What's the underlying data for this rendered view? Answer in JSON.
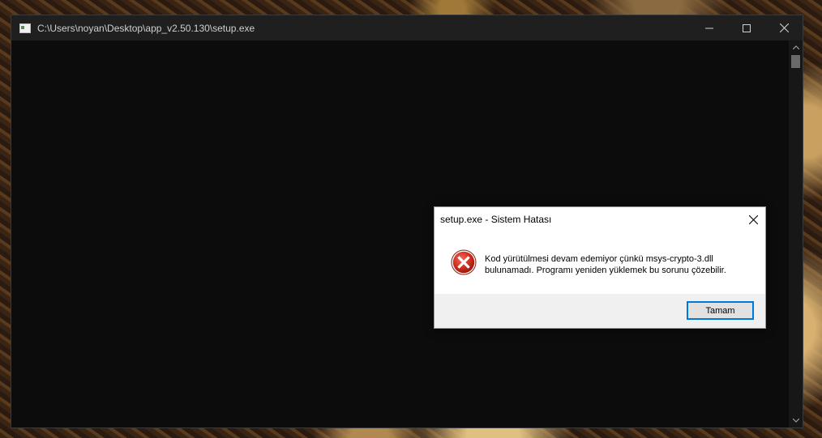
{
  "console_window": {
    "title": "C:\\Users\\noyan\\Desktop\\app_v2.50.130\\setup.exe",
    "controls": {
      "minimize_icon": "minimize-icon",
      "maximize_icon": "maximize-icon",
      "close_icon": "close-icon"
    }
  },
  "dialog": {
    "title": "setup.exe - Sistem Hatası",
    "icon": "error-icon",
    "message_line1": "Kod yürütülmesi devam edemiyor çünkü msys-crypto-3.dll",
    "message_line2": "bulunamadı. Programı yeniden yüklemek bu sorunu çözebilir.",
    "ok_label": "Tamam"
  },
  "colors": {
    "console_bg": "#0c0c0c",
    "titlebar_bg": "#1f1f1f",
    "error_red": "#c42b1c",
    "button_focus": "#0078d7"
  }
}
